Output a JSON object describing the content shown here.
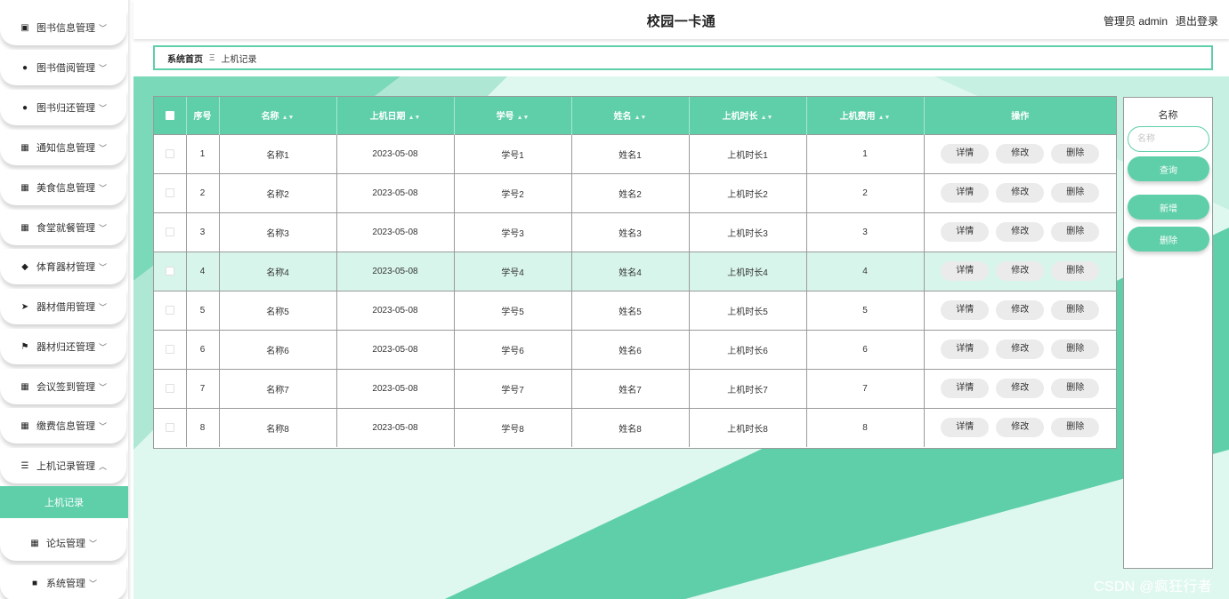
{
  "header": {
    "title": "校园一卡通",
    "user_label": "管理员 admin",
    "logout_label": "退出登录"
  },
  "sidebar": {
    "items": [
      {
        "label": "图书信息管理",
        "icon": "calendar-x-icon",
        "glyph": "▣"
      },
      {
        "label": "图书借阅管理",
        "icon": "user-icon",
        "glyph": "●"
      },
      {
        "label": "图书归还管理",
        "icon": "user-icon",
        "glyph": "●"
      },
      {
        "label": "通知信息管理",
        "icon": "grid-icon",
        "glyph": "▦"
      },
      {
        "label": "美食信息管理",
        "icon": "grid-icon",
        "glyph": "▦"
      },
      {
        "label": "食堂就餐管理",
        "icon": "grid-icon",
        "glyph": "▦"
      },
      {
        "label": "体育器材管理",
        "icon": "pin-icon",
        "glyph": "◆"
      },
      {
        "label": "器材借用管理",
        "icon": "paper-plane-icon",
        "glyph": "➤"
      },
      {
        "label": "器材归还管理",
        "icon": "flag-icon",
        "glyph": "⚑"
      },
      {
        "label": "会议签到管理",
        "icon": "apps-icon",
        "glyph": "▦"
      },
      {
        "label": "缴费信息管理",
        "icon": "grid-icon",
        "glyph": "▦"
      },
      {
        "label": "上机记录管理",
        "icon": "list-icon",
        "glyph": "☰"
      },
      {
        "label": "论坛管理",
        "icon": "grid-icon",
        "glyph": "▦"
      },
      {
        "label": "系统管理",
        "icon": "video-icon",
        "glyph": "■"
      }
    ],
    "sub_item": "上机记录"
  },
  "breadcrumb": {
    "home": "系统首页",
    "separator": "Ξ",
    "current": "上机记录"
  },
  "table": {
    "headers": [
      "序号",
      "名称",
      "上机日期",
      "学号",
      "姓名",
      "上机时长",
      "上机费用",
      "操作"
    ],
    "rows": [
      [
        "1",
        "名称1",
        "2023-05-08",
        "学号1",
        "姓名1",
        "上机时长1",
        "1"
      ],
      [
        "2",
        "名称2",
        "2023-05-08",
        "学号2",
        "姓名2",
        "上机时长2",
        "2"
      ],
      [
        "3",
        "名称3",
        "2023-05-08",
        "学号3",
        "姓名3",
        "上机时长3",
        "3"
      ],
      [
        "4",
        "名称4",
        "2023-05-08",
        "学号4",
        "姓名4",
        "上机时长4",
        "4"
      ],
      [
        "5",
        "名称5",
        "2023-05-08",
        "学号5",
        "姓名5",
        "上机时长5",
        "5"
      ],
      [
        "6",
        "名称6",
        "2023-05-08",
        "学号6",
        "姓名6",
        "上机时长6",
        "6"
      ],
      [
        "7",
        "名称7",
        "2023-05-08",
        "学号7",
        "姓名7",
        "上机时长7",
        "7"
      ],
      [
        "8",
        "名称8",
        "2023-05-08",
        "学号8",
        "姓名8",
        "上机时长8",
        "8"
      ]
    ],
    "actions": [
      "详情",
      "修改",
      "删除"
    ],
    "highlighted_row": 4
  },
  "search_panel": {
    "label": "名称",
    "placeholder": "名称",
    "search_button": "查询",
    "add_button": "新增",
    "delete_button": "删除"
  },
  "watermark": "CSDN @疯狂行者",
  "colors": {
    "accent": "#5fcfaa",
    "row_highlight": "#d8f5ec",
    "button_gray": "#ebebeb"
  }
}
